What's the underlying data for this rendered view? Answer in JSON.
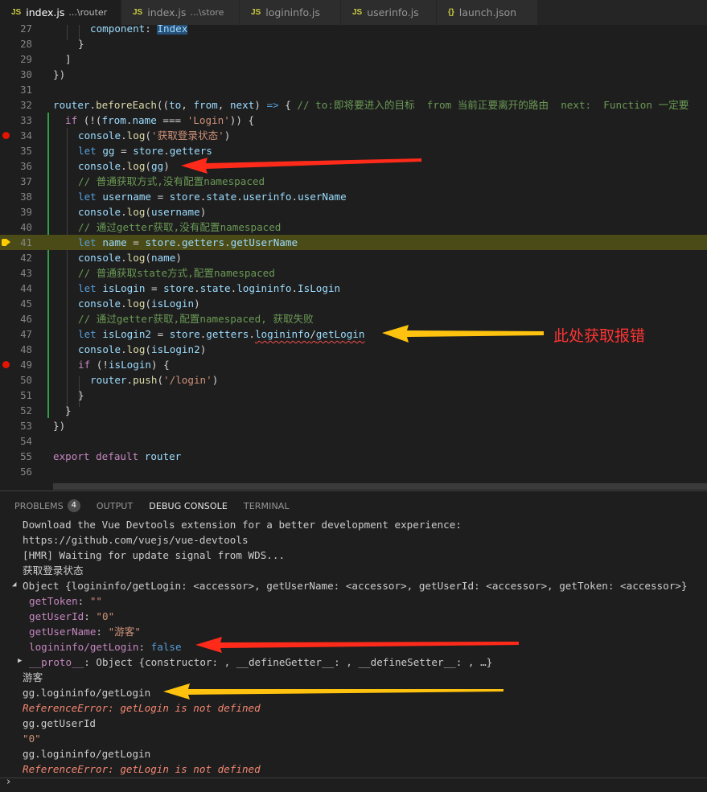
{
  "tabs": [
    {
      "label": "index.js",
      "desc": "...\\router",
      "icon": "JS",
      "active": true,
      "modified": true
    },
    {
      "label": "index.js",
      "desc": "...\\store",
      "icon": "JS",
      "active": false,
      "modified": false
    },
    {
      "label": "logininfo.js",
      "desc": "",
      "icon": "JS",
      "active": false,
      "modified": false
    },
    {
      "label": "userinfo.js",
      "desc": "",
      "icon": "JS",
      "active": false,
      "modified": false
    },
    {
      "label": "launch.json",
      "desc": "",
      "icon": "{}",
      "active": false,
      "modified": false
    }
  ],
  "editor": {
    "line_numbers": [
      "27",
      "28",
      "29",
      "30",
      "31",
      "32",
      "33",
      "34",
      "35",
      "36",
      "37",
      "38",
      "39",
      "40",
      "41",
      "42",
      "43",
      "44",
      "45",
      "46",
      "47",
      "48",
      "49",
      "50",
      "51",
      "52",
      "53",
      "54",
      "55",
      "56"
    ],
    "l27": {
      "prop": "component",
      "colon": ": ",
      "val": "Index"
    },
    "l28": "}",
    "l29": "]",
    "l30": "})",
    "l32": {
      "a": "router",
      "b": ".",
      "c": "beforeEach",
      "d": "((",
      "e": "to",
      "f": ", ",
      "g": "from",
      "h": ", ",
      "i": "next",
      "j": ") ",
      "k": "=>",
      "l": " { ",
      "m": "// to:即将要进入的目标  from 当前正要离开的路由  next:  Function 一定要"
    },
    "l33": {
      "a": "if",
      "b": " (!(",
      "c": "from",
      "d": ".",
      "e": "name",
      "f": " === ",
      "g": "'Login'",
      "h": ")) {"
    },
    "l34": {
      "a": "console",
      "b": ".",
      "c": "log",
      "d": "(",
      "e": "'获取登录状态'",
      "f": ")"
    },
    "l35": {
      "a": "let",
      "b": " ",
      "c": "gg",
      "d": " = ",
      "e": "store",
      "f": ".",
      "g": "getters"
    },
    "l36": {
      "a": "console",
      "b": ".",
      "c": "log",
      "d": "(",
      "e": "gg",
      "f": ")"
    },
    "l37": "// 普通获取方式,没有配置namespaced",
    "l38": {
      "a": "let",
      "b": " ",
      "c": "username",
      "d": " = ",
      "e": "store",
      "f": ".",
      "g": "state",
      "h": ".",
      "i": "userinfo",
      "j": ".",
      "k": "userName"
    },
    "l39": {
      "a": "console",
      "b": ".",
      "c": "log",
      "d": "(",
      "e": "username",
      "f": ")"
    },
    "l40": "// 通过getter获取,没有配置namespaced",
    "l41": {
      "a": "let",
      "b": " ",
      "c": "name",
      "d": " = ",
      "e": "store",
      "f": ".",
      "g": "getters",
      "h": ".",
      "i": "getUserName"
    },
    "l42": {
      "a": "console",
      "b": ".",
      "c": "log",
      "d": "(",
      "e": "name",
      "f": ")"
    },
    "l43": "// 普通获取state方式,配置namespaced",
    "l44": {
      "a": "let",
      "b": " ",
      "c": "isLogin",
      "d": " = ",
      "e": "store",
      "f": ".",
      "g": "state",
      "h": ".",
      "i": "logininfo",
      "j": ".",
      "k": "IsLogin"
    },
    "l45": {
      "a": "console",
      "b": ".",
      "c": "log",
      "d": "(",
      "e": "isLogin",
      "f": ")"
    },
    "l46": "// 通过getter获取,配置namespaced, 获取失败",
    "l47": {
      "a": "let",
      "b": " ",
      "c": "isLogin2",
      "d": " = ",
      "e": "store",
      "f": ".",
      "g": "getters",
      "h": ".",
      "i": "logininfo",
      "j": "/",
      "k": "getLogin"
    },
    "l48": {
      "a": "console",
      "b": ".",
      "c": "log",
      "d": "(",
      "e": "isLogin2",
      "f": ")"
    },
    "l49": {
      "a": "if",
      "b": " (!",
      "c": "isLogin",
      "d": ") {"
    },
    "l50": {
      "a": "router",
      "b": ".",
      "c": "push",
      "d": "(",
      "e": "'/login'",
      "f": ")"
    },
    "l51": "}",
    "l52": "}",
    "l53": "})",
    "l55": {
      "a": "export",
      "b": " ",
      "c": "default",
      "d": " ",
      "e": "router"
    }
  },
  "annotation": {
    "text": "此处获取报错",
    "arrow_colors": {
      "red": "#ff2a1a",
      "yellow": "#ffc20e"
    }
  },
  "panel": {
    "tabs": {
      "problems": "PROBLEMS",
      "problems_count": "4",
      "output": "OUTPUT",
      "debug": "DEBUG CONSOLE",
      "terminal": "TERMINAL"
    },
    "console": {
      "c1": "Download the Vue Devtools extension for a better development experience:",
      "c2": "https://github.com/vuejs/vue-devtools",
      "c3": "[HMR] Waiting for update signal from WDS...",
      "c4": "获取登录状态",
      "c5": "Object {logininfo/getLogin: <accessor>, getUserName: <accessor>, getUserId: <accessor>, getToken: <accessor>}",
      "c6k": "getToken",
      "c6v": "\"\"",
      "c7k": "getUserId",
      "c7v": "\"0\"",
      "c8k": "getUserName",
      "c8v": "\"游客\"",
      "c9k": "logininfo/getLogin",
      "c9v": "false",
      "c10k": "__proto__",
      "c10v": "Object {constructor: , __defineGetter__: , __defineSetter__: , …}",
      "c11": "游客",
      "c12": "gg.logininfo/getLogin",
      "c13": "ReferenceError: getLogin is not defined",
      "c14": "gg.getUserId",
      "c15": "\"0\"",
      "c16": "gg.logininfo/getLogin",
      "c17": "ReferenceError: getLogin is not defined"
    },
    "prompt": "›"
  }
}
